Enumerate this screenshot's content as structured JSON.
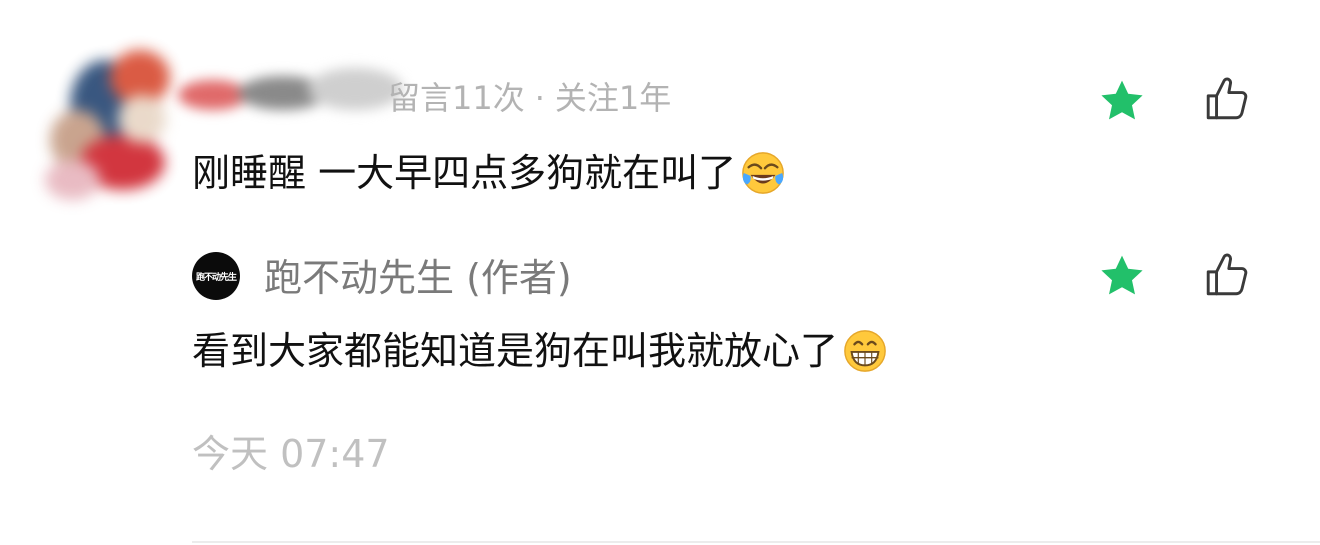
{
  "comment": {
    "meta": {
      "count_label": "留言11次",
      "separator": "·",
      "follow_label": "关注1年"
    },
    "text": "刚睡醒 一大早四点多狗就在叫了",
    "emoji": "face-with-tears-of-joy-emoji"
  },
  "reply": {
    "author_avatar_text": "跑不动先生",
    "author_name": "跑不动先生 (作者)",
    "text": "看到大家都能知道是狗在叫我就放心了",
    "emoji": "grinning-face-emoji"
  },
  "timestamp": "今天 07:47",
  "colors": {
    "star": "#22c06a",
    "icon_outline": "#3a3a3a",
    "meta_text": "#b3b3b3",
    "body_text": "#111111",
    "author_text": "#7a7a7a",
    "timestamp_text": "#c0c0c0"
  }
}
